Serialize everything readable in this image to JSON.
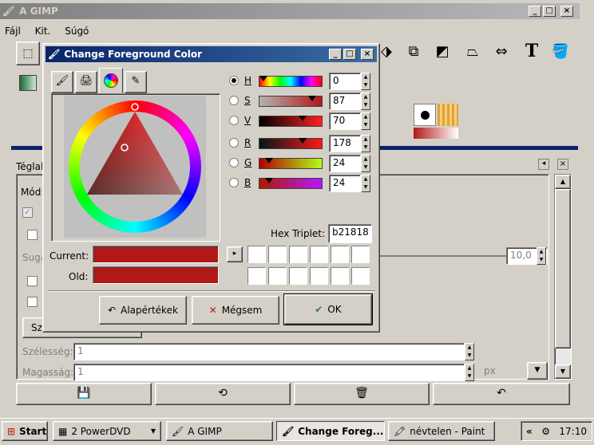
{
  "main_window": {
    "title": "A GIMP",
    "menu": [
      "Fájl",
      "Kit.",
      "Súgó"
    ],
    "side_label_partial": "Téglal",
    "mode_label_partial": "Mód:",
    "sug_label_partial": "Suga",
    "sz_button_partial": "Sz",
    "width_label": "Szélesség:",
    "width_value": "1",
    "height_label": "Magasság:",
    "height_value": "1",
    "unit_value": "px",
    "value_field": "10,0"
  },
  "dialog": {
    "title": "Change Foreground Color",
    "tabs": [
      "paint-tab",
      "printer-tab",
      "wheel-tab",
      "brush-tab"
    ],
    "channels": [
      {
        "key": "H",
        "value": "0",
        "checked": true,
        "marker_frac": 0.0
      },
      {
        "key": "S",
        "value": "87",
        "checked": false,
        "marker_frac": 0.87
      },
      {
        "key": "V",
        "value": "70",
        "checked": false,
        "marker_frac": 0.7
      },
      {
        "key": "R",
        "value": "178",
        "checked": false,
        "marker_frac": 0.698
      },
      {
        "key": "G",
        "value": "24",
        "checked": false,
        "marker_frac": 0.094
      },
      {
        "key": "B",
        "value": "24",
        "checked": false,
        "marker_frac": 0.094
      }
    ],
    "hex_label": "Hex Triplet:",
    "hex_value": "b21818",
    "current_label": "Current:",
    "old_label": "Old:",
    "current_color": "#b21818",
    "old_color": "#b21818",
    "buttons": {
      "defaults": "Alapértékek",
      "cancel": "Mégsem",
      "ok": "OK"
    }
  },
  "taskbar": {
    "start": "Start",
    "items": [
      "2 PowerDVD",
      "A GIMP",
      "Change Foreg...",
      "névtelen - Paint"
    ],
    "clock": "17:10"
  }
}
